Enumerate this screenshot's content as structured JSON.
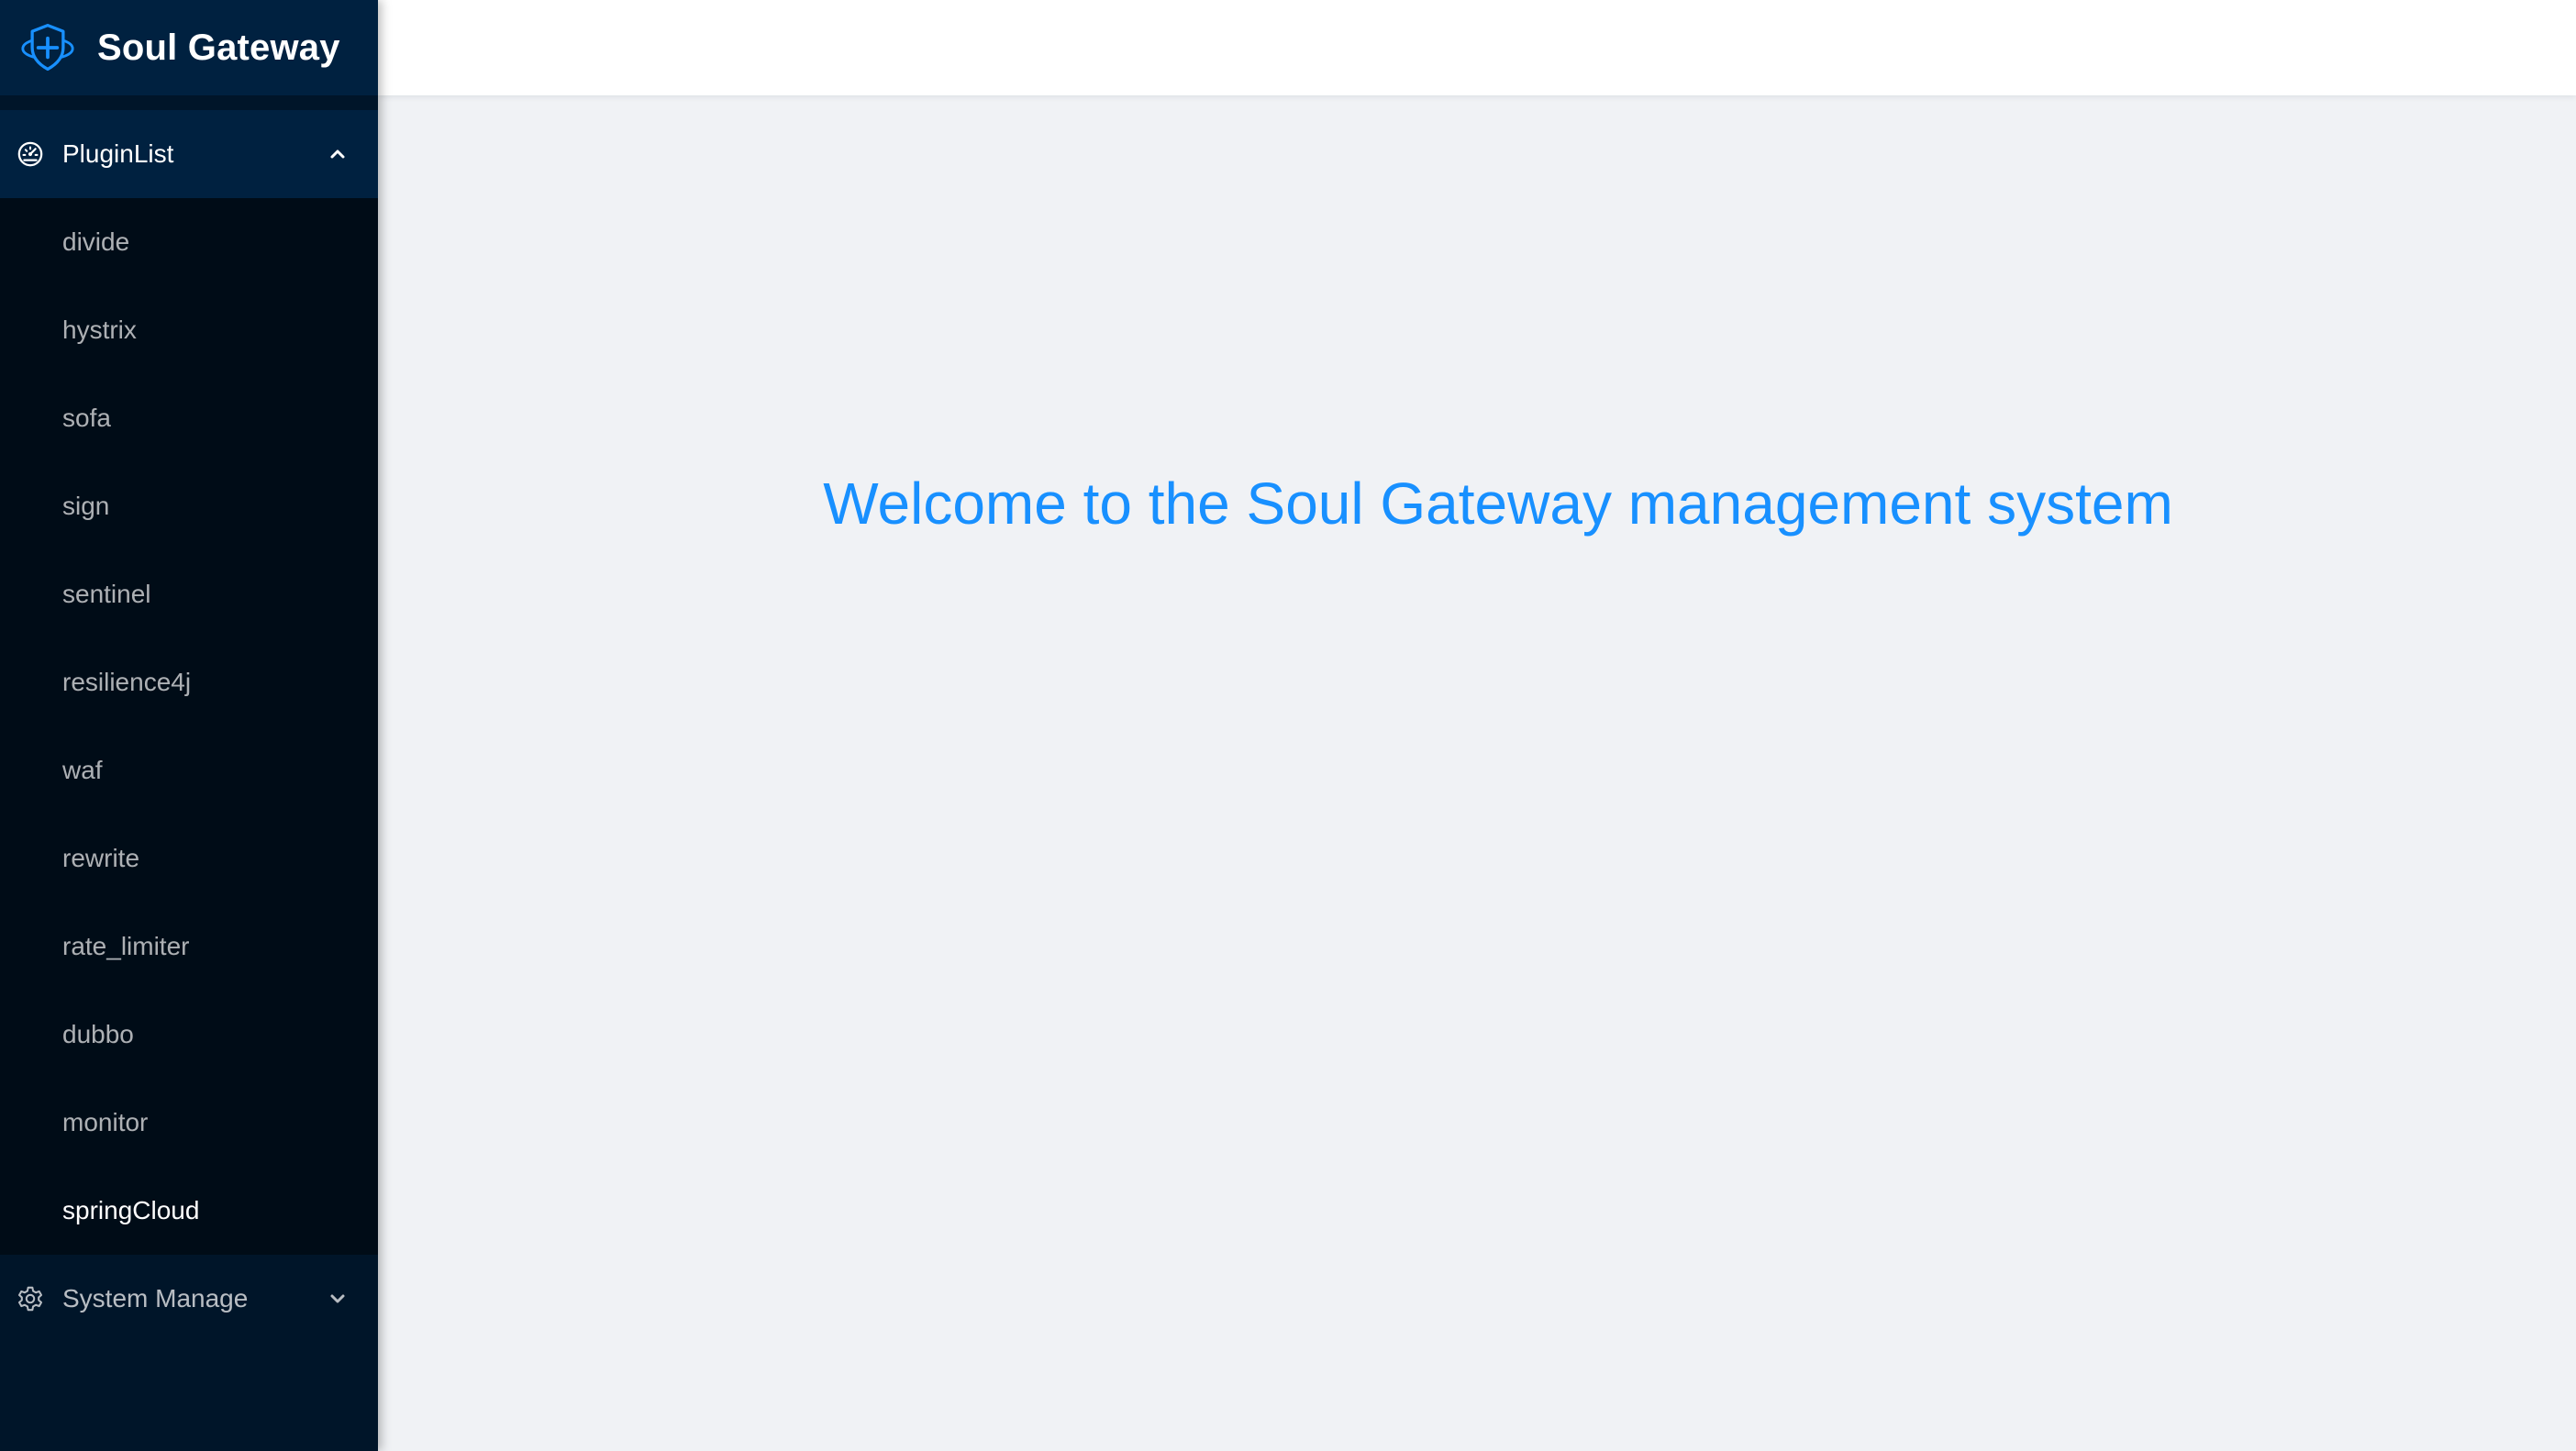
{
  "app": {
    "title": "Soul Gateway",
    "logo_icon": "shield-plus-icon"
  },
  "sidebar": {
    "plugin_menu": {
      "label": "PluginList",
      "icon": "dashboard-icon",
      "expanded": true,
      "items": [
        {
          "label": "divide"
        },
        {
          "label": "hystrix"
        },
        {
          "label": "sofa"
        },
        {
          "label": "sign"
        },
        {
          "label": "sentinel"
        },
        {
          "label": "resilience4j"
        },
        {
          "label": "waf"
        },
        {
          "label": "rewrite"
        },
        {
          "label": "rate_limiter"
        },
        {
          "label": "dubbo"
        },
        {
          "label": "monitor"
        },
        {
          "label": "springCloud"
        }
      ],
      "active_item": "springCloud"
    },
    "system_menu": {
      "label": "System Manage",
      "icon": "gear-icon",
      "expanded": false
    }
  },
  "main": {
    "welcome": "Welcome to the Soul Gateway management system"
  },
  "colors": {
    "sidebar_bg": "#001529",
    "submenu_bg": "#000c17",
    "accent": "#1890ff",
    "content_bg": "#f0f2f5"
  }
}
